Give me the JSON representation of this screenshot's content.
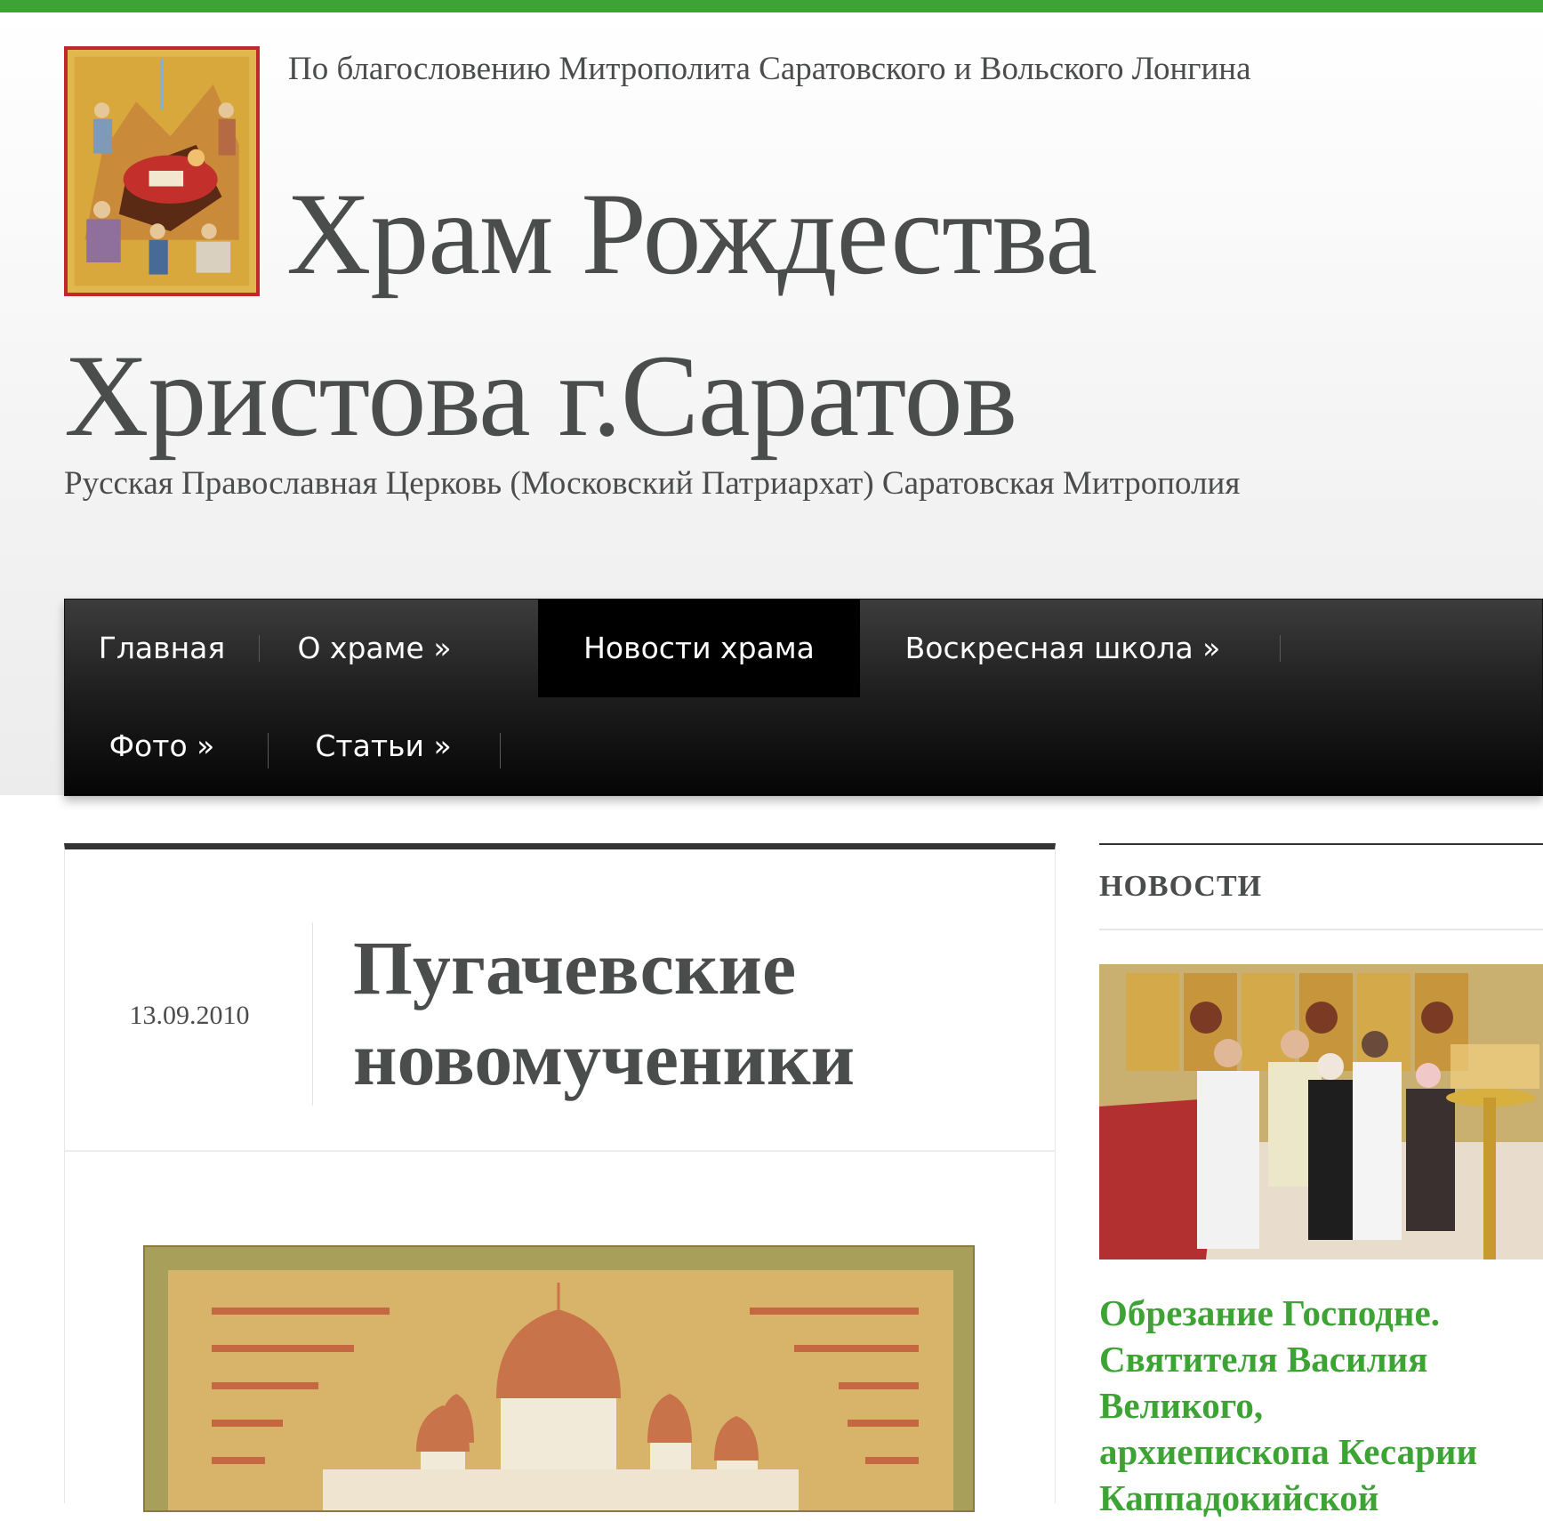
{
  "header": {
    "blessing": "По благословению Митрополита Саратовского и Вольского Лонгина",
    "site_title": "Храм Рождества Христова г.Саратов",
    "site_description": "Русская Православная Церковь (Московский Патриархат) Саратовская Митрополия"
  },
  "nav": {
    "items": [
      {
        "label": "Главная"
      },
      {
        "label": "О храме »"
      },
      {
        "label": "Новости храма"
      },
      {
        "label": "Воскресная школа »"
      },
      {
        "label": "Фото »"
      },
      {
        "label": "Статьи »"
      }
    ],
    "active_index": 2
  },
  "post": {
    "date": "13.09.2010",
    "title": "Пугачевские новомученики"
  },
  "sidebar": {
    "widget_title": "НОВОСТИ",
    "news_title_lines": [
      "Обрезание Господне.",
      "Святителя Василия",
      "Великого,",
      "архиепископа Кесарии",
      "Каппадокийской"
    ]
  },
  "colors": {
    "accent_green": "#3ea335",
    "text": "#4a4d4b",
    "logo_border": "#c0282b"
  }
}
